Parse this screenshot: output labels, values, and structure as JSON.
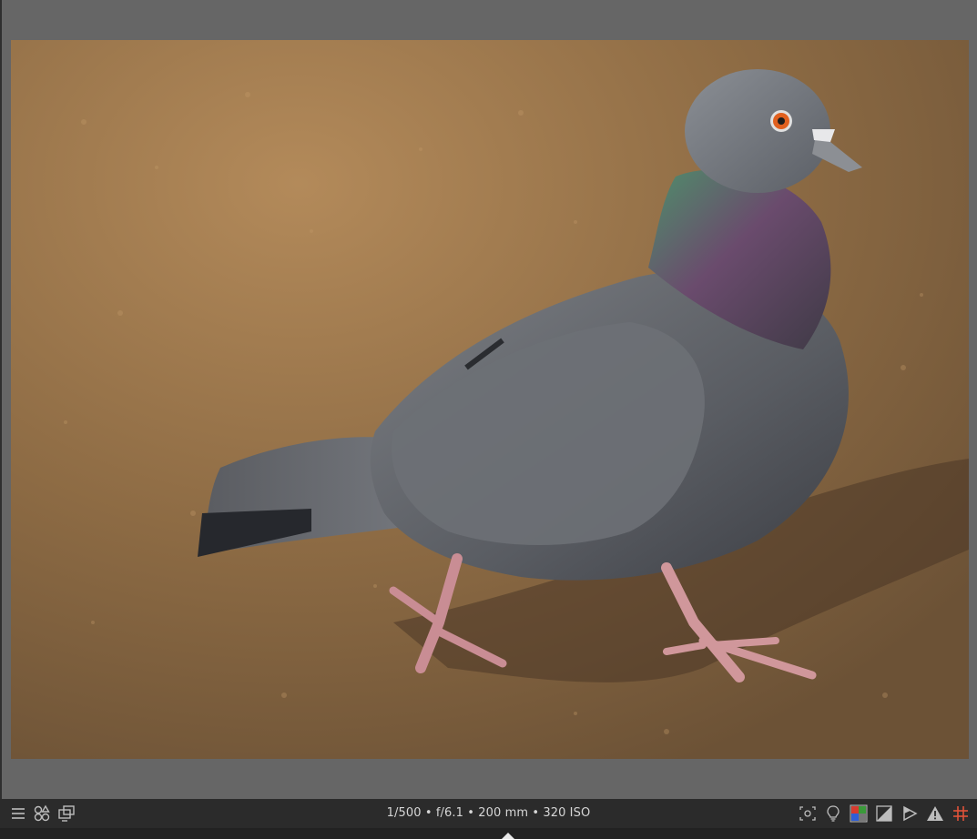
{
  "image": {
    "subject": "pigeon-photo"
  },
  "status_bar": {
    "exif": "1/500 • f/6.1 • 200 mm • 320 ISO"
  },
  "icons": {
    "left": [
      "menu-icon",
      "shapes-icon",
      "monitor-icon"
    ],
    "right": [
      "focus-mask-icon",
      "lightbulb-icon",
      "color-swatch-icon",
      "before-after-icon",
      "clipping-icon",
      "warning-icon",
      "grid-icon"
    ]
  },
  "colors": {
    "background": "#666666",
    "bar": "#2b2b2b",
    "grid_accent": "#e0533a"
  }
}
